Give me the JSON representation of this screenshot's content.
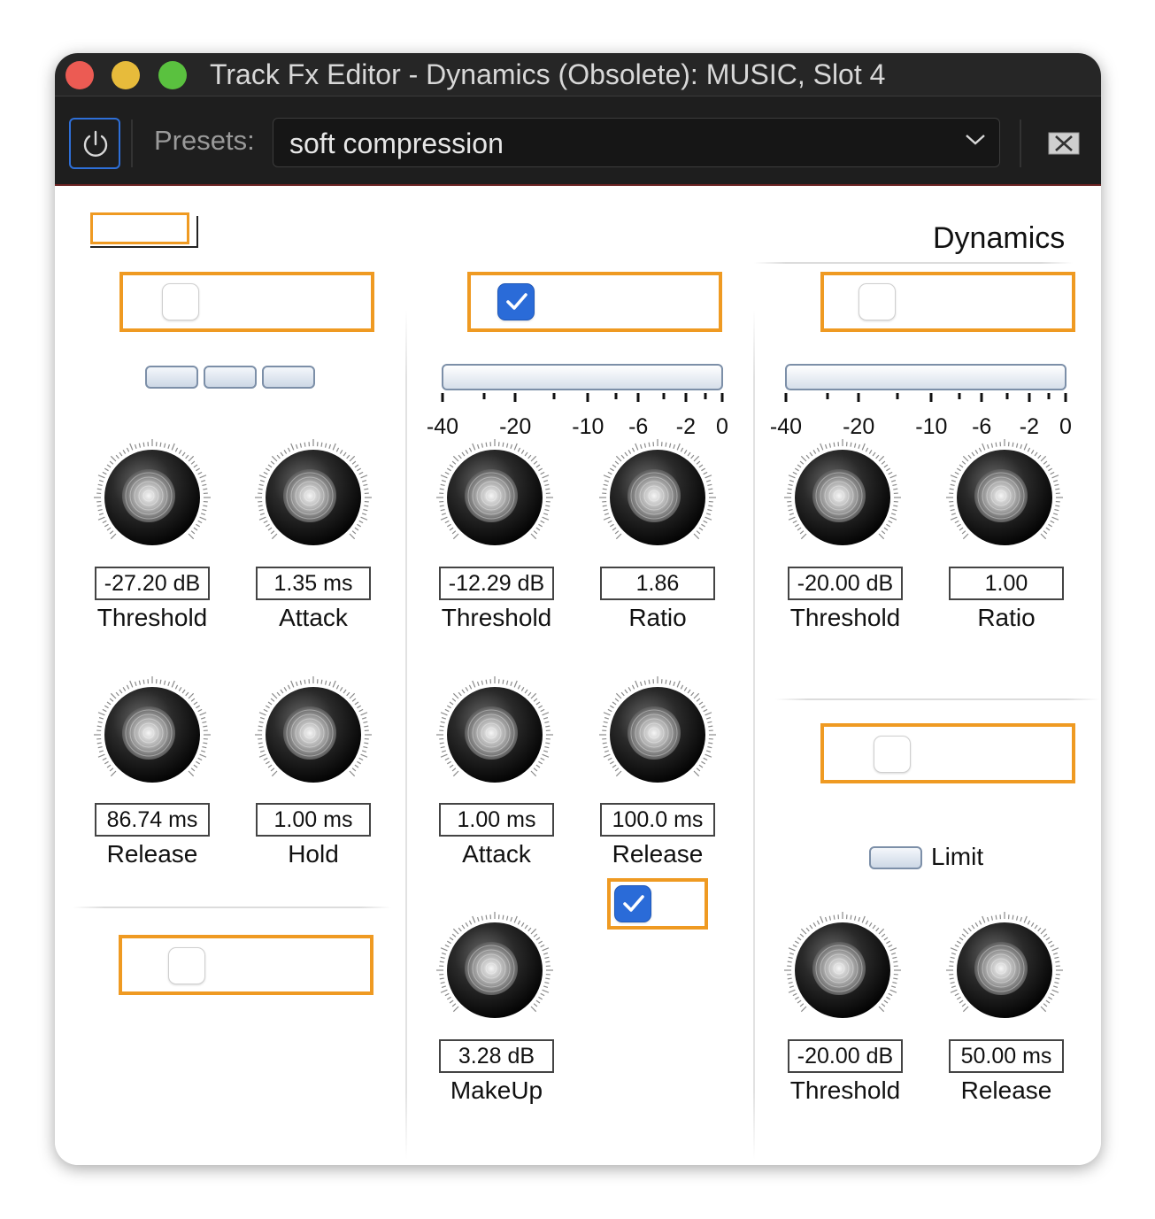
{
  "window": {
    "title": "Track Fx Editor - Dynamics (Obsolete): MUSIC, Slot 4"
  },
  "toolbar": {
    "power_icon": "power-icon",
    "presets_label": "Presets:",
    "preset_value": "soft compression",
    "close_icon": "close-x-icon"
  },
  "plugin": {
    "name": "Dynamics"
  },
  "gate": {
    "enabled": false,
    "threshold": {
      "value": "-27.20 dB",
      "label": "Threshold"
    },
    "attack": {
      "value": "1.35 ms",
      "label": "Attack"
    },
    "release": {
      "value": "86.74 ms",
      "label": "Release"
    },
    "hold": {
      "value": "1.00 ms",
      "label": "Hold"
    },
    "bottom_enabled": false
  },
  "compressor": {
    "enabled": true,
    "meter_scale": [
      "-40",
      "-20",
      "-10",
      "-6",
      "-2",
      "0"
    ],
    "threshold": {
      "value": "-12.29 dB",
      "label": "Threshold"
    },
    "ratio": {
      "value": "1.86",
      "label": "Ratio"
    },
    "attack": {
      "value": "1.00 ms",
      "label": "Attack"
    },
    "release": {
      "value": "100.0 ms",
      "label": "Release"
    },
    "auto_release_checked": true,
    "makeup": {
      "value": "3.28 dB",
      "label": "MakeUp"
    }
  },
  "expander": {
    "enabled": false,
    "meter_scale": [
      "-40",
      "-20",
      "-10",
      "-6",
      "-2",
      "0"
    ],
    "threshold": {
      "value": "-20.00 dB",
      "label": "Threshold"
    },
    "ratio": {
      "value": "1.00",
      "label": "Ratio"
    }
  },
  "limiter": {
    "enabled": false,
    "limit_label": "Limit",
    "threshold": {
      "value": "-20.00 dB",
      "label": "Threshold"
    },
    "release": {
      "value": "50.00 ms",
      "label": "Release"
    }
  },
  "colors": {
    "highlight_orange": "#ef9a22",
    "checkbox_blue": "#2a6bd8",
    "titlebar": "#262626",
    "toolbar": "#1e1e1e"
  }
}
